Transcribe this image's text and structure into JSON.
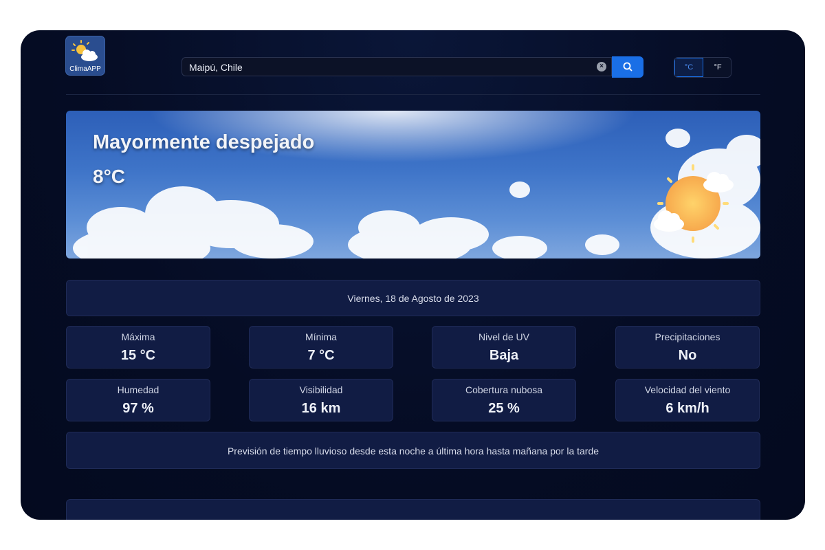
{
  "app": {
    "logo_text": "ClimaAPP"
  },
  "search": {
    "value": "Maipú, Chile",
    "placeholder": ""
  },
  "units": {
    "celsius": "°C",
    "fahrenheit": "°F",
    "selected": "°C"
  },
  "hero": {
    "condition": "Mayormente despejado",
    "temperature": "8°C"
  },
  "date": "Viernes, 18 de Agosto de 2023",
  "stats": [
    {
      "label": "Máxima",
      "value": "15 °C"
    },
    {
      "label": "Mínima",
      "value": "7 °C"
    },
    {
      "label": "Nivel de UV",
      "value": "Baja"
    },
    {
      "label": "Precipitaciones",
      "value": "No"
    },
    {
      "label": "Humedad",
      "value": "97 %"
    },
    {
      "label": "Visibilidad",
      "value": "16 km"
    },
    {
      "label": "Cobertura nubosa",
      "value": "25 %"
    },
    {
      "label": "Velocidad del viento",
      "value": "6 km/h"
    }
  ],
  "forecast": "Previsión de tiempo lluvioso desde esta noche a última hora hasta mañana por la tarde",
  "colors": {
    "accent": "#1a6fe6",
    "background": "#07112c",
    "card": "#111c44"
  }
}
